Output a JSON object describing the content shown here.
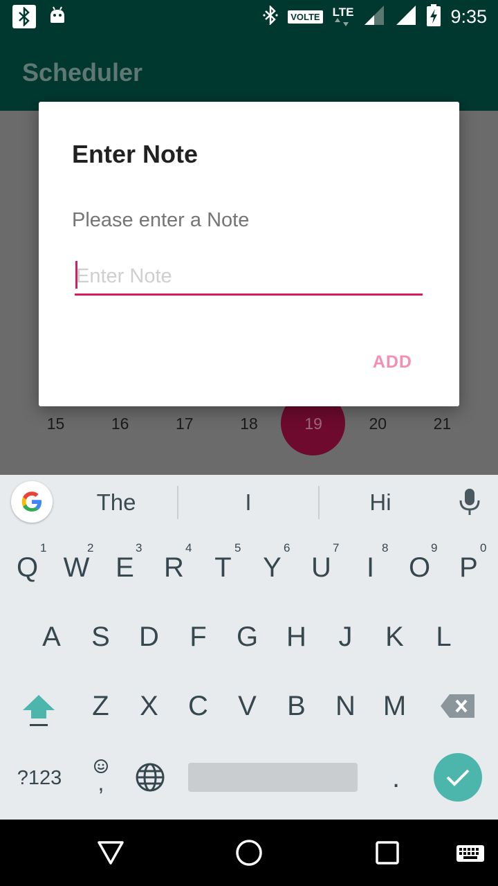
{
  "status_bar": {
    "time": "9:35",
    "volte": "VOLTE",
    "lte": "LTE",
    "icons": [
      "bluetooth-icon",
      "android-icon",
      "bluetooth-icon",
      "signal-icon",
      "signal-icon",
      "battery-charging-icon"
    ]
  },
  "app_bar": {
    "title": "Scheduler"
  },
  "calendar": {
    "days": [
      "15",
      "16",
      "17",
      "18",
      "19",
      "20",
      "21"
    ],
    "selected": "19",
    "selected_color": "#6d0a2e"
  },
  "dialog": {
    "title": "Enter Note",
    "message": "Please enter a Note",
    "input_placeholder": "Enter Note",
    "input_value": "",
    "add_label": "ADD",
    "accent": "#d81b60"
  },
  "keyboard": {
    "suggestions": [
      "The",
      "I",
      "Hi"
    ],
    "row1": [
      "Q",
      "W",
      "E",
      "R",
      "T",
      "Y",
      "U",
      "I",
      "O",
      "P"
    ],
    "row1_hints": [
      "1",
      "2",
      "3",
      "4",
      "5",
      "6",
      "7",
      "8",
      "9",
      "0"
    ],
    "row2": [
      "A",
      "S",
      "D",
      "F",
      "G",
      "H",
      "J",
      "K",
      "L"
    ],
    "row3": [
      "Z",
      "X",
      "C",
      "V",
      "B",
      "N",
      "M"
    ],
    "symbols_label": "?123",
    "period_label": ".",
    "comma_label": ",",
    "accent": "#4db6ac"
  }
}
